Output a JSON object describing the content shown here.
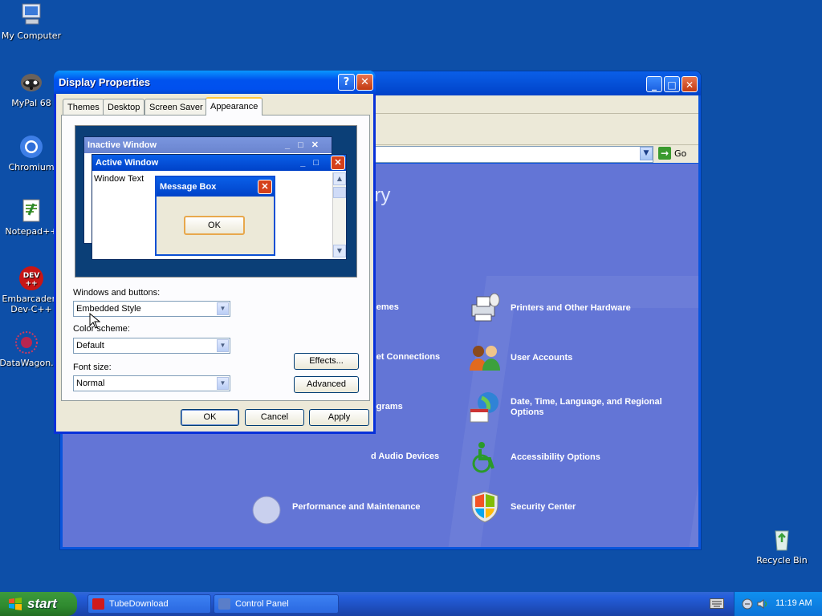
{
  "desktop": {
    "icons": [
      {
        "label": "My Computer",
        "icon": "computer-icon"
      },
      {
        "label": "MyPal 68",
        "icon": "mypal-raccoon-icon"
      },
      {
        "label": "Chromium",
        "icon": "chromium-icon"
      },
      {
        "label": "Notepad++",
        "icon": "notepadpp-icon"
      },
      {
        "label": "Embarcadero Dev-C++",
        "label_line1": "Embarcadero",
        "label_line2": "Dev-C++",
        "icon": "devcpp-icon"
      },
      {
        "label": "DataWagon.",
        "icon": "datawagon-icon"
      },
      {
        "label": "Recycle Bin",
        "icon": "recycle-bin-icon"
      }
    ]
  },
  "control_panel": {
    "address": {
      "go_label": "Go"
    },
    "heading": "ory",
    "categories": [
      {
        "label": "hemes",
        "icon": "themes-icon"
      },
      {
        "label": "Printers and Other Hardware",
        "icon": "printer-icon"
      },
      {
        "label": "net Connections",
        "icon": "network-icon"
      },
      {
        "label": "User Accounts",
        "icon": "users-icon"
      },
      {
        "label": "ograms",
        "icon": "programs-icon"
      },
      {
        "label": "Date, Time, Language, and Regional Options",
        "line1": "Date, Time, Language, and Regional",
        "line2": "Options",
        "icon": "globe-calendar-icon"
      },
      {
        "label": "d Audio Devices",
        "icon": "audio-icon"
      },
      {
        "label": "Accessibility Options",
        "icon": "accessibility-icon"
      },
      {
        "label": "Performance and Maintenance",
        "icon": "performance-icon"
      },
      {
        "label": "Security Center",
        "icon": "shield-icon"
      }
    ]
  },
  "dialog": {
    "title": "Display Properties",
    "help": "?",
    "tabs": [
      "Themes",
      "Desktop",
      "Screen Saver",
      "Appearance"
    ],
    "active_tab": "Appearance",
    "preview": {
      "inactive_title": "Inactive Window",
      "active_title": "Active Window",
      "window_text": "Window Text",
      "message_title": "Message Box",
      "ok": "OK"
    },
    "windows_buttons_label": "Windows and buttons:",
    "windows_buttons_value": "Embedded Style",
    "color_scheme_label": "Color scheme:",
    "color_scheme_value": "Default",
    "font_size_label": "Font size:",
    "font_size_value": "Normal",
    "effects_label": "Effects...",
    "advanced_label": "Advanced",
    "ok_label": "OK",
    "cancel_label": "Cancel",
    "apply_label": "Apply"
  },
  "taskbar": {
    "start_label": "start",
    "tasks": [
      {
        "label": "TubeDownload",
        "color": "#d11a1a"
      },
      {
        "label": "Control Panel",
        "color": "#5a7ec9"
      }
    ],
    "clock": "11:19 AM"
  },
  "colors": {
    "desktop": "#0d4fa8",
    "cp_body": "#6375d6",
    "title_blue": "#0053ee"
  }
}
